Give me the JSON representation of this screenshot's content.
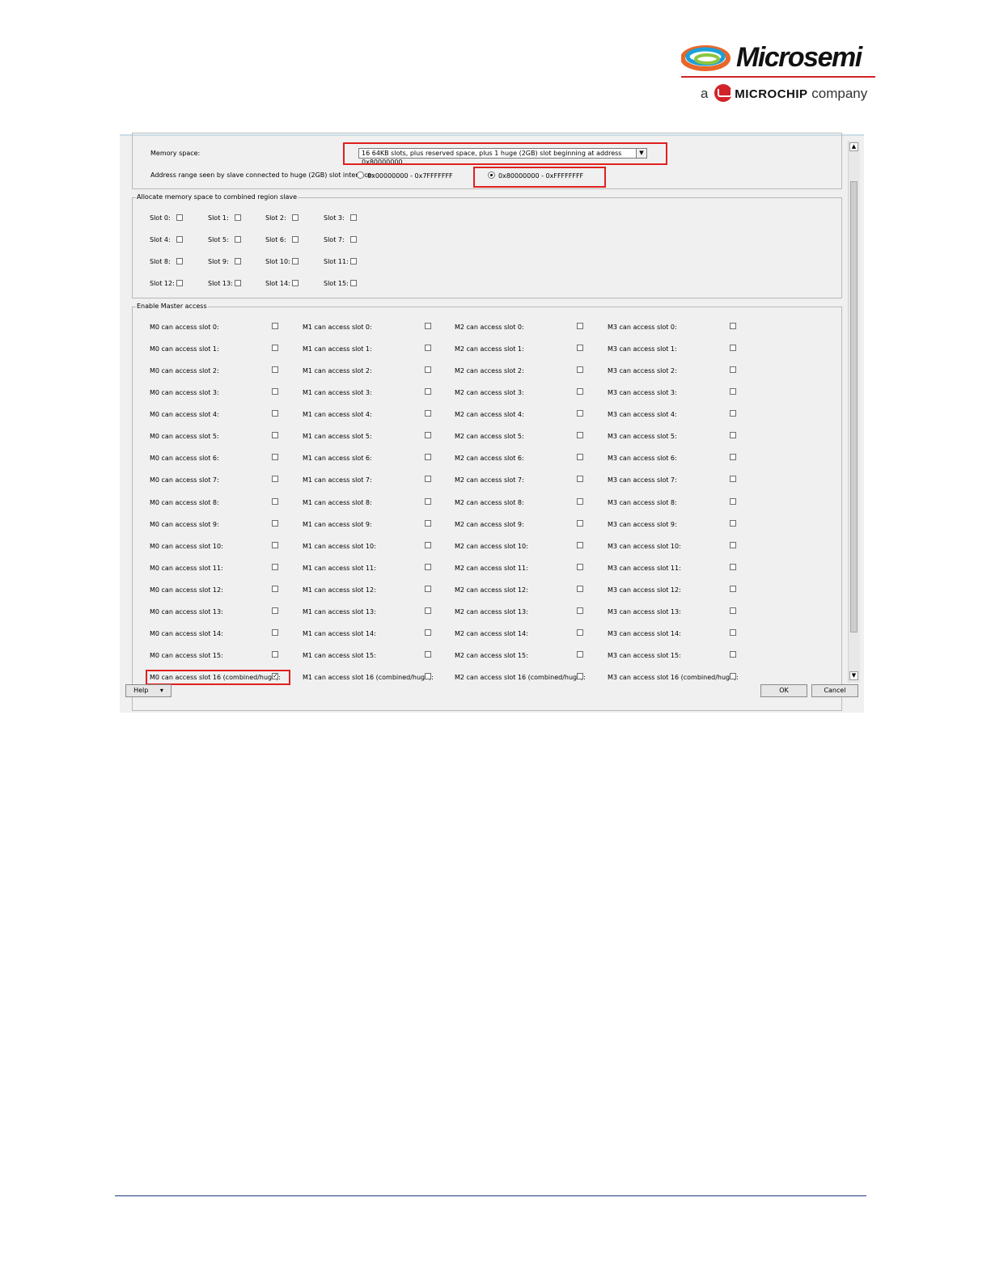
{
  "logo": {
    "brand": "Microsemi",
    "tagline_pre": "a",
    "tagline_brand": "MICROCHIP",
    "tagline_post": "company"
  },
  "memory_space": {
    "label": "Memory space:",
    "selected": "16 64KB slots, plus reserved space, plus 1 huge (2GB) slot beginning at address 0x80000000"
  },
  "address_range": {
    "label": "Address range seen by slave connected to huge (2GB) slot interface:",
    "options": [
      "0x00000000 - 0x7FFFFFFF",
      "0x80000000 - 0xFFFFFFFF"
    ],
    "selected_index": 1
  },
  "combined_region": {
    "title": "Allocate memory space to combined region slave",
    "slots": [
      "Slot 0:",
      "Slot 1:",
      "Slot 2:",
      "Slot 3:",
      "Slot 4:",
      "Slot 5:",
      "Slot 6:",
      "Slot 7:",
      "Slot 8:",
      "Slot 9:",
      "Slot 10:",
      "Slot 11:",
      "Slot 12:",
      "Slot 13:",
      "Slot 14:",
      "Slot 15:"
    ]
  },
  "master_access": {
    "title": "Enable Master access",
    "masters": [
      "M0",
      "M1",
      "M2",
      "M3"
    ],
    "rows": [
      "slot 0:",
      "slot 1:",
      "slot 2:",
      "slot 3:",
      "slot 4:",
      "slot 5:",
      "slot 6:",
      "slot 7:",
      "slot 8:",
      "slot 9:",
      "slot 10:",
      "slot 11:",
      "slot 12:",
      "slot 13:",
      "slot 14:",
      "slot 15:",
      "slot 16 (combined/huge):"
    ],
    "row_prefix": " can access ",
    "checked": [
      "M0 can access slot 16 (combined/huge):"
    ]
  },
  "buttons": {
    "help": "Help",
    "ok": "OK",
    "cancel": "Cancel"
  },
  "icons": {
    "dropdown": "▼",
    "scroll_up": "▲",
    "scroll_down": "▼",
    "help_arrow": "▾"
  },
  "colors": {
    "highlight": "#e02020",
    "brand_red": "#d2232a"
  }
}
